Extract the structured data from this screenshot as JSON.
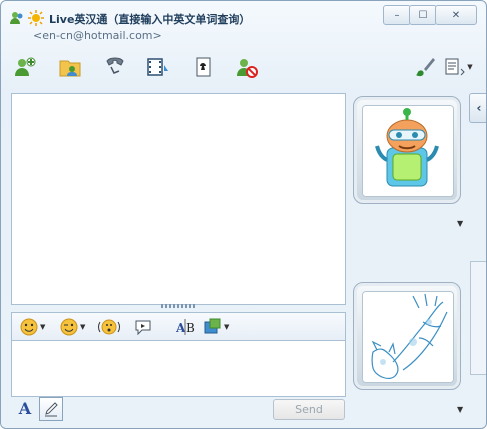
{
  "window": {
    "title": "Live英汉通（直接输入中英文单词查询）",
    "subtitle": "<en-cn@hotmail.com>",
    "controls": {
      "minimize": "–",
      "maximize": "☐",
      "close": "✕"
    }
  },
  "toolbar": {
    "items": [
      {
        "name": "invite-contact",
        "icon": "add-contact-icon"
      },
      {
        "name": "send-files",
        "icon": "send-files-icon"
      },
      {
        "name": "call",
        "icon": "phone-icon"
      },
      {
        "name": "video",
        "icon": "video-icon"
      },
      {
        "name": "games",
        "icon": "games-icon"
      },
      {
        "name": "block",
        "icon": "block-contact-icon"
      },
      {
        "name": "background",
        "icon": "paintbrush-icon"
      },
      {
        "name": "show-menu",
        "icon": "menu-icon"
      }
    ]
  },
  "compose": {
    "send_label": "Send",
    "font_label": "A"
  }
}
